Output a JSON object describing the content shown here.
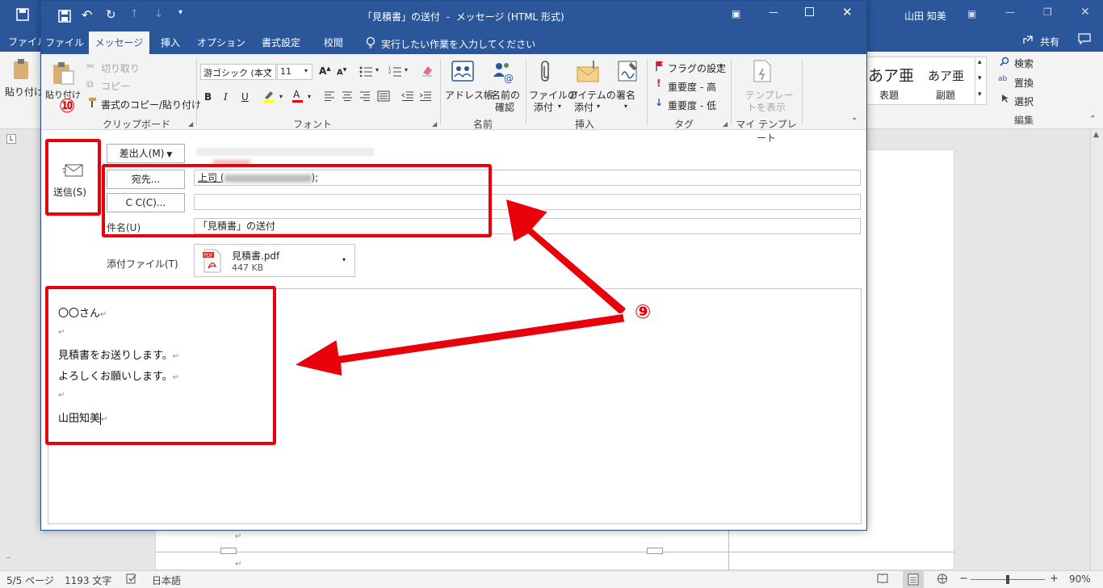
{
  "word": {
    "user_name": "山田 知美",
    "tab_file": "ファイル",
    "share": "共有",
    "ribbon": {
      "paste": "貼り付け",
      "style1": "あア亜",
      "style1_label": "表題",
      "style2": "あア亜",
      "style2_label": "副題",
      "find": "検索",
      "replace": "置換",
      "select": "選択",
      "edit_group": "編集"
    },
    "status": {
      "page": "5/5 ページ",
      "words": "1193 文字",
      "language": "日本語",
      "zoom": "90%"
    }
  },
  "message": {
    "window_title": "「見積書」の送付  -  メッセージ (HTML 形式)",
    "tabs": [
      "ファイル",
      "メッセージ",
      "挿入",
      "オプション",
      "書式設定",
      "校閲"
    ],
    "tell_me": "実行したい作業を入力してください",
    "ribbon": {
      "paste": "貼り付け",
      "cut": "切り取り",
      "copy": "コピー",
      "format_painter": "書式のコピー/貼り付け",
      "clipboard": "クリップボード",
      "font_name": "游ゴシック (本文",
      "font_size": "11",
      "font_group": "フォント",
      "address_book": "アドレス帳",
      "check_names_1": "名前の",
      "check_names_2": "確認",
      "names_group": "名前",
      "attach_file_1": "ファイルの",
      "attach_file_2": "添付",
      "attach_item_1": "アイテムの",
      "attach_item_2": "添付",
      "signature": "署名",
      "insert_group": "挿入",
      "follow_up": "フラグの設定",
      "high_importance": "重要度 - 高",
      "low_importance": "重要度 - 低",
      "tags_group": "タグ",
      "template_1": "テンプレー",
      "template_2": "トを表示",
      "my_templates": "マイ テンプレート"
    },
    "compose": {
      "send": "送信(S)",
      "from": "差出人(M)",
      "to_button": "宛先...",
      "to_value_prefix": "上司 (",
      "to_value_suffix": ");",
      "cc_button": "C C(C)...",
      "subject_label": "件名(U)",
      "subject_value": "「見積書」の送付",
      "attached_label": "添付ファイル(T)",
      "attachment_name": "見積書.pdf",
      "attachment_size": "447 KB"
    },
    "body_lines": [
      "〇〇さん",
      "",
      "見積書をお送りします。",
      "よろしくお願いします。",
      "",
      "山田知美"
    ]
  },
  "annotations": {
    "step_send": "⑩",
    "step_fill": "⑨",
    "highlight_color": "#e8000b"
  }
}
